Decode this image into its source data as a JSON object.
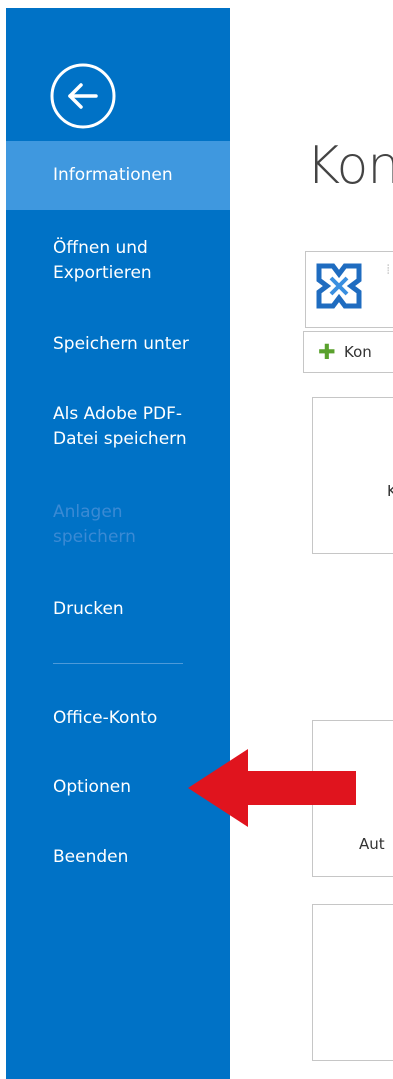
{
  "nav": {
    "items": [
      {
        "label": "Informationen",
        "state": "active"
      },
      {
        "label": "Öffnen und\nExportieren",
        "state": "normal"
      },
      {
        "label": "Speichern unter",
        "state": "normal"
      },
      {
        "label": "Als Adobe PDF-\nDatei speichern",
        "state": "normal"
      },
      {
        "label": "Anlagen\nspeichern",
        "state": "disabled"
      },
      {
        "label": "Drucken",
        "state": "normal"
      },
      {
        "label": "Office-Konto",
        "state": "normal"
      },
      {
        "label": "Optionen",
        "state": "normal"
      },
      {
        "label": "Beenden",
        "state": "normal"
      }
    ],
    "back_icon": "back-arrow-circle-icon"
  },
  "main": {
    "title": "Kon",
    "add_account_label": "Kon",
    "card1_text": "K",
    "card2_text": "Aut"
  },
  "annotation": {
    "arrow_color": "#e0141e",
    "arrow_target": "Optionen"
  },
  "colors": {
    "sidebar": "#0072c6",
    "active_item": "#3f98df",
    "disabled_text": "#3a8ad4"
  }
}
